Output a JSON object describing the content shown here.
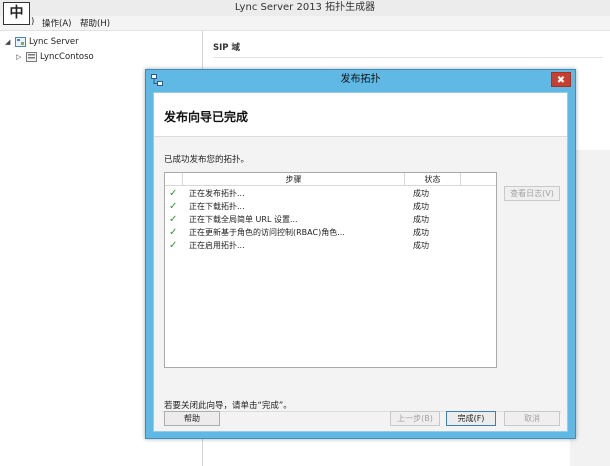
{
  "app": {
    "title": "Lync Server 2013 拓扑生成器",
    "ime_indicator": "中"
  },
  "menubar": {
    "items": [
      {
        "label": ")"
      },
      {
        "label": "操作(A)"
      },
      {
        "label": "帮助(H)"
      }
    ]
  },
  "tree": {
    "root": {
      "label": "Lync Server",
      "expanded": true
    },
    "child": {
      "label": "LyncContoso",
      "expanded": false
    }
  },
  "right_pane": {
    "section_header": "SIP 域"
  },
  "dialog": {
    "title": "发布拓扑",
    "close_glyph": "✖",
    "heading": "发布向导已完成",
    "success_message": "已成功发布您的拓扑。",
    "columns": {
      "step": "步骤",
      "status": "状态"
    },
    "rows": [
      {
        "step": "正在发布拓扑...",
        "status": "成功"
      },
      {
        "step": "正在下载拓扑...",
        "status": "成功"
      },
      {
        "step": "正在下载全局简单 URL 设置...",
        "status": "成功"
      },
      {
        "step": "正在更新基于角色的访问控制(RBAC)角色...",
        "status": "成功"
      },
      {
        "step": "正在启用拓扑...",
        "status": "成功"
      }
    ],
    "check_glyph": "✓",
    "view_log_label": "查看日志(V)",
    "close_hint": "若要关闭此向导，请单击“完成”。",
    "buttons": {
      "help": "帮助",
      "back": "上一步(B)",
      "finish": "完成(F)",
      "cancel": "取消"
    }
  },
  "colors": {
    "dialog_frame": "#5fb9e4",
    "close_button": "#c7402f",
    "success_check": "#2e9a2e"
  }
}
